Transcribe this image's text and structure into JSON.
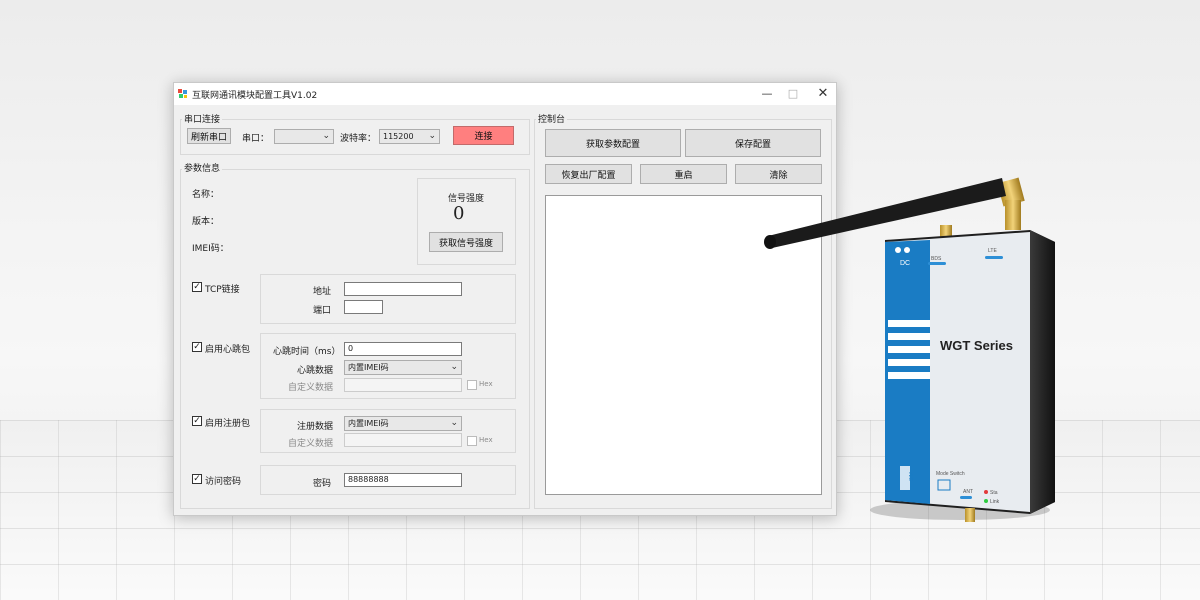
{
  "window": {
    "title": "互联网通讯模块配置工具V1.02",
    "controls": {
      "minimize": "—",
      "maximize": "□",
      "close": "✕"
    }
  },
  "serial": {
    "group_label": "串口连接",
    "refresh_label": "刷新串口",
    "port_label": "串口：",
    "port_value": "",
    "baud_label": "波特率：",
    "baud_value": "115200",
    "connect_label": "连接",
    "connect_color": "#ff7f7f"
  },
  "params": {
    "group_label": "参数信息",
    "name_label": "名称：",
    "version_label": "版本：",
    "imei_label": "IMEI码：",
    "signal_title": "信号强度",
    "signal_value": "0",
    "get_signal_label": "获取信号强度"
  },
  "tcp": {
    "checkbox_label": "TCP链接",
    "checked": true,
    "address_label": "地址",
    "address_value": "",
    "port_label": "端口",
    "port_value": ""
  },
  "heartbeat": {
    "checkbox_label": "启用心跳包",
    "checked": true,
    "time_label": "心跳时间（ms）",
    "time_value": "0",
    "data_label": "心跳数据",
    "data_value": "内置IMEI码",
    "custom_label": "自定义数据",
    "custom_value": "",
    "hex_label": "Hex"
  },
  "register": {
    "checkbox_label": "启用注册包",
    "checked": true,
    "data_label": "注册数据",
    "data_value": "内置IMEI码",
    "custom_label": "自定义数据",
    "custom_value": "",
    "hex_label": "Hex"
  },
  "password": {
    "checkbox_label": "访问密码",
    "checked": true,
    "label": "密码",
    "value": "88888888"
  },
  "console": {
    "group_label": "控制台",
    "get_config_label": "获取参数配置",
    "save_config_label": "保存配置",
    "factory_reset_label": "恢复出厂配置",
    "restart_label": "重启",
    "clear_label": "清除",
    "output": ""
  },
  "device": {
    "series_label": "WGT Series",
    "dc_label": "DC",
    "bds_label": "BDS",
    "lte_label": "LTE",
    "sim_label": "SIM",
    "mode_switch_label": "Mode Switch",
    "ant_label": "ANT",
    "sta_label": "Sta",
    "link_label": "Link",
    "body_color": "#1f1f1f",
    "panel_color": "#1a7cc4"
  }
}
